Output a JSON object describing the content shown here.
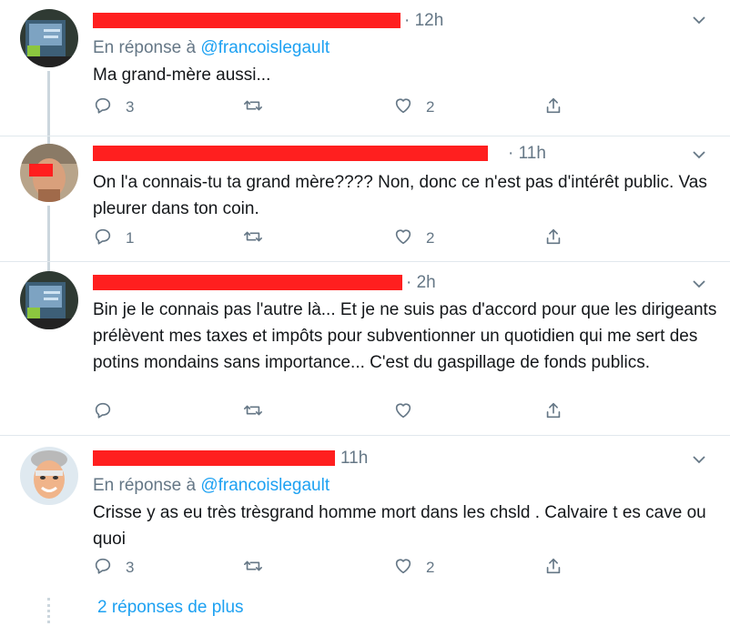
{
  "tweets": [
    {
      "time": "· 12h",
      "reply_prefix": "En réponse à",
      "reply_handle": "@francoislegault",
      "text": "Ma grand-mère aussi...",
      "replies": "3",
      "retweets": "",
      "likes": "2"
    },
    {
      "time": "· 11h",
      "reply_prefix": "",
      "reply_handle": "",
      "text": "On l'a connais-tu ta grand mère???? Non, donc ce n'est pas d'intérêt public. Vas pleurer dans ton coin.",
      "replies": "1",
      "retweets": "",
      "likes": "2"
    },
    {
      "time": "· 2h",
      "reply_prefix": "",
      "reply_handle": "",
      "text": "Bin je le connais pas l'autre là... Et je ne suis pas d'accord pour que les dirigeants prélèvent mes taxes et impôts pour subventionner un quotidien qui me sert des potins mondains sans importance... C'est du gaspillage de fonds publics.",
      "replies": "",
      "retweets": "",
      "likes": ""
    },
    {
      "time": "11h",
      "reply_prefix": "En réponse à",
      "reply_handle": "@francoislegault",
      "text": "Crisse y as eu très trèsgrand  homme mort dans les chsld . Calvaire t es cave ou quoi",
      "replies": "3",
      "retweets": "",
      "likes": "2"
    }
  ],
  "more_replies": "2 réponses de plus",
  "icons": {
    "reply": "reply-icon",
    "retweet": "retweet-icon",
    "like": "heart-icon",
    "share": "share-icon",
    "menu": "chevron-down-icon"
  },
  "colors": {
    "accent": "#1da1f2",
    "muted": "#657786",
    "redaction": "#ff1f1f",
    "divider": "#e1e8ed"
  }
}
